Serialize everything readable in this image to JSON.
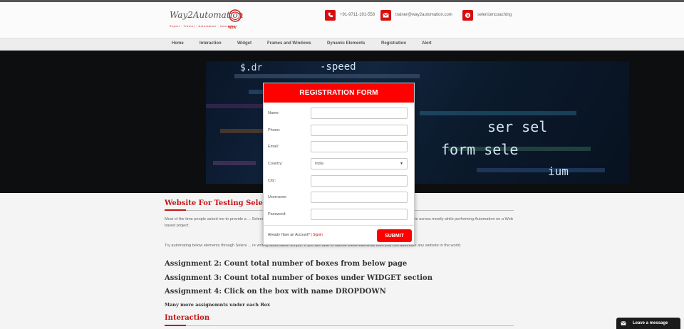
{
  "header": {
    "logo_text": "Way2Automation",
    "logo_tagline": "Expert · Trainer · Automation · Consultant",
    "logo_badge": "W2A",
    "phone": "+91-9711-191-558",
    "email": "trainer@way2automation.com",
    "skype": "seleniumcoaching"
  },
  "nav": {
    "items": [
      "Home",
      "Interaction",
      "Widget",
      "Frames and Windows",
      "Dynamic Elements",
      "Registration",
      "Alert"
    ]
  },
  "hero": {
    "code_lines": [
      "$.dr",
      "-speed",
      "form sele",
      "ser sel",
      "ium"
    ]
  },
  "content": {
    "heading": "Website For Testing Seleniu",
    "para1": "Most of the time people asked me to provide a ... Selenium or QTP scripts. This is one of the Website I specially built which can fulfil the ba ... te across mostly while performing Automation on a Web based project .",
    "para2": "Try automating below elements through Seleni ... re writing automation scripts. If you are able to handle these elements then you can automate any website in the world.",
    "assignment2": "Assignment 2: Count total number of boxes from below page",
    "assignment3": "Assignment 3: Count total number of boxes under WIDGET section",
    "assignment4": "Assignment 4: Click on the box with name DROPDOWN",
    "more": "Many more assignemnts under each Box",
    "interaction_heading": "Interaction"
  },
  "modal": {
    "title": "REGISTRATION FORM",
    "labels": {
      "name": "Name:",
      "phone": "Phone:",
      "email": "Email:",
      "country": "Country:",
      "city": "City:",
      "username": "Username:",
      "password": "Password:"
    },
    "values": {
      "name": "",
      "phone": "",
      "email": "",
      "country": "India",
      "city": "",
      "username": "",
      "password": ""
    },
    "account_text": "Already Have an Account? |",
    "signin": "Signin",
    "submit": "SUBMIT"
  },
  "chat": {
    "label": "Leave a message"
  },
  "colors": {
    "accent": "#ff0000",
    "brand_red": "#d50f0f",
    "heading_red": "#c31616",
    "hero_bg": "#0d0e10"
  }
}
